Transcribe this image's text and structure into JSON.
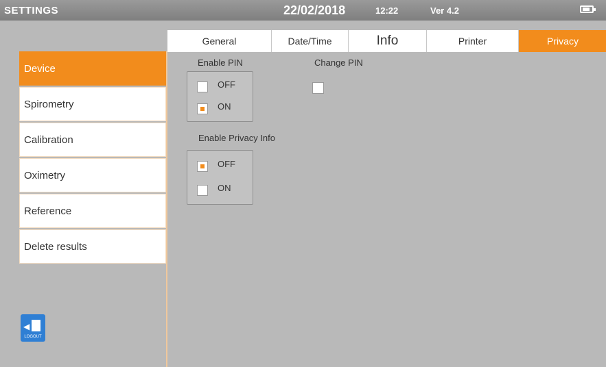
{
  "topbar": {
    "title": "SETTINGS",
    "date": "22/02/2018",
    "time": "12:22",
    "version": "Ver 4.2",
    "battery_icon": "battery-icon"
  },
  "tabs": [
    {
      "label": "General",
      "active": false
    },
    {
      "label": "Date/Time",
      "active": false
    },
    {
      "label": "Info",
      "active": false
    },
    {
      "label": "Printer",
      "active": false
    },
    {
      "label": "Privacy",
      "active": true
    }
  ],
  "sidebar": {
    "items": [
      {
        "label": "Device",
        "active": true
      },
      {
        "label": "Spirometry",
        "active": false
      },
      {
        "label": "Calibration",
        "active": false
      },
      {
        "label": "Oximetry",
        "active": false
      },
      {
        "label": "Reference",
        "active": false
      },
      {
        "label": "Delete results",
        "active": false
      }
    ]
  },
  "privacy": {
    "enable_pin": {
      "label": "Enable PIN",
      "options": [
        {
          "label": "OFF",
          "checked": false
        },
        {
          "label": "ON",
          "checked": true
        }
      ]
    },
    "change_pin": {
      "label": "Change PIN",
      "checked": false
    },
    "enable_privacy_info": {
      "label": "Enable Privacy Info",
      "options": [
        {
          "label": "OFF",
          "checked": true
        },
        {
          "label": "ON",
          "checked": false
        }
      ]
    }
  },
  "exit_button": {
    "icon": "exit-door-icon",
    "caption": "LOGOUT"
  },
  "colors": {
    "accent": "#f28c1c",
    "background": "#b9b9b9",
    "exit_blue": "#2f7fd4"
  }
}
